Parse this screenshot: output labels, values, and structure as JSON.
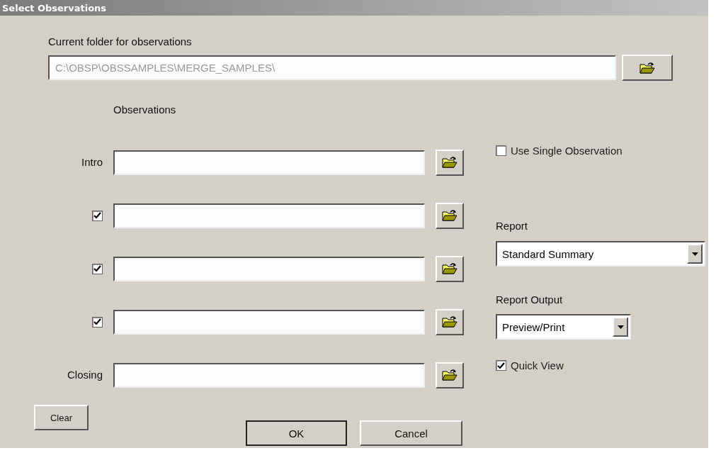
{
  "window": {
    "title": "Select Observations"
  },
  "current_folder": {
    "label": "Current folder for observations",
    "value": "C:\\OBSP\\OBSSAMPLES\\MERGE_SAMPLES\\"
  },
  "observations": {
    "label": "Observations",
    "rows": [
      {
        "kind": "label",
        "label": "Intro"
      },
      {
        "kind": "checkbox",
        "checked": true
      },
      {
        "kind": "checkbox",
        "checked": true
      },
      {
        "kind": "checkbox",
        "checked": true
      },
      {
        "kind": "label",
        "label": "Closing"
      }
    ]
  },
  "use_single_observation": {
    "label": "Use Single Observation",
    "checked": false
  },
  "report": {
    "label": "Report",
    "value": "Standard Summary"
  },
  "report_output": {
    "label": "Report Output",
    "value": "Preview/Print"
  },
  "quick_view": {
    "label": "Quick View",
    "checked": true
  },
  "buttons": {
    "clear": "Clear",
    "ok": "OK",
    "cancel": "Cancel"
  }
}
